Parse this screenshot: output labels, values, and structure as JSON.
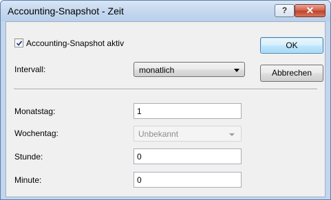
{
  "window": {
    "title": "Accounting-Snapshot - Zeit",
    "help_label": "?",
    "close_label": "✕"
  },
  "form": {
    "snapshot_active": {
      "label": "Accounting-Snapshot aktiv",
      "checked": true
    },
    "interval": {
      "label": "Intervall:",
      "value": "monatlich"
    },
    "monatstag": {
      "label": "Monatstag:",
      "value": "1"
    },
    "wochentag": {
      "label": "Wochentag:",
      "value": "Unbekannt"
    },
    "stunde": {
      "label": "Stunde:",
      "value": "0"
    },
    "minute": {
      "label": "Minute:",
      "value": "0"
    }
  },
  "buttons": {
    "ok": "OK",
    "cancel": "Abbrechen"
  },
  "icons": {
    "help": "help-icon",
    "close": "close-icon",
    "check": "checkmark-icon",
    "dropdown": "chevron-down-icon"
  }
}
